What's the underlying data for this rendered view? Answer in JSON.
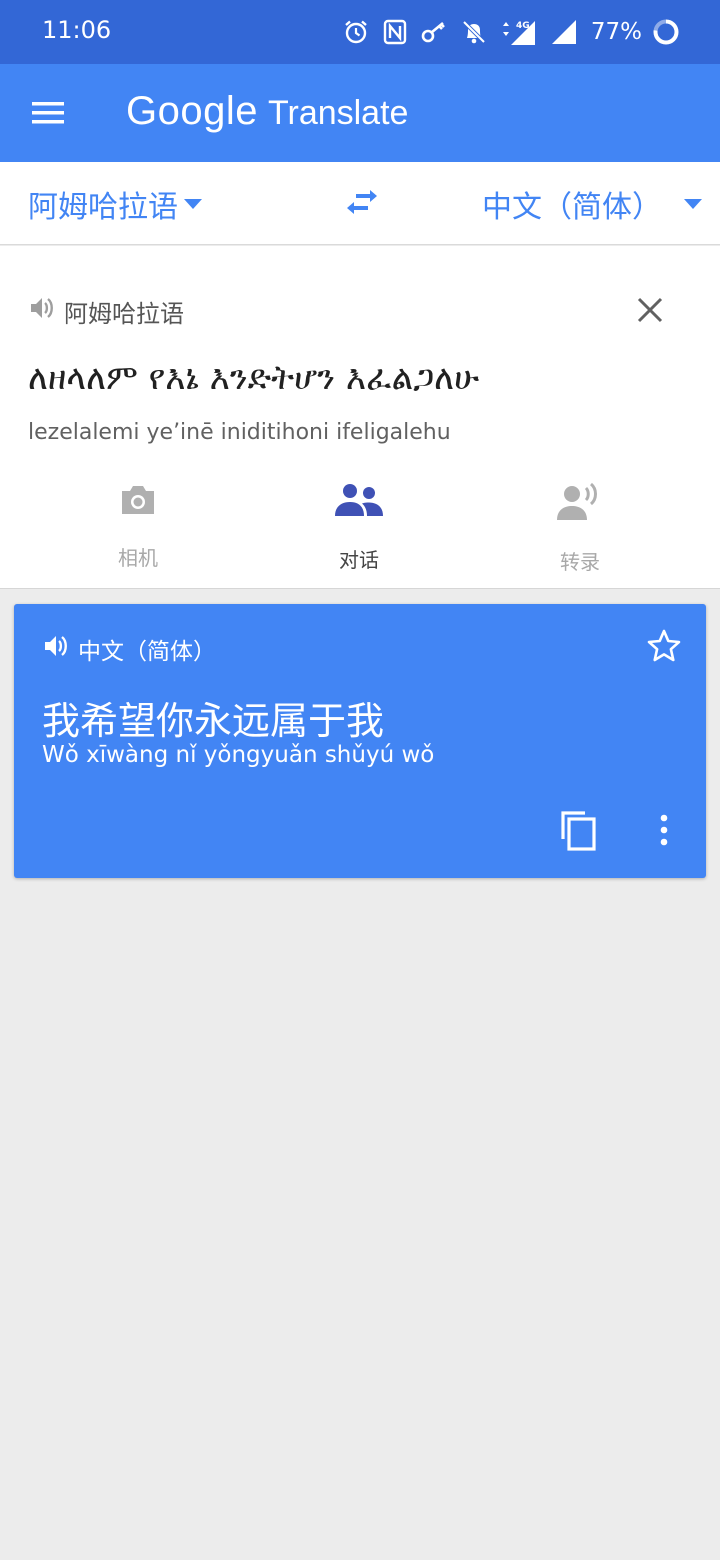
{
  "status_bar": {
    "time": "11:06",
    "network": "4G",
    "battery": "77%",
    "icons": [
      "alarm-icon",
      "nfc-icon",
      "vpn-key-icon",
      "notifications-off-icon",
      "data-arrows-icon",
      "signal-icon",
      "signal-icon",
      "battery-ring-icon"
    ]
  },
  "app_bar": {
    "brand": "Google",
    "product": "Translate"
  },
  "languages": {
    "source": "阿姆哈拉语",
    "target": "中文（简体）"
  },
  "input": {
    "source_lang_label": "阿姆哈拉语",
    "source_text": "ለዘላለም የእኔ እንድትሆን እፈልጋለሁ",
    "transliteration": "lezelalemi ye’inē iniditihoni ifeligalehu"
  },
  "tools": {
    "camera": "相机",
    "conversation": "对话",
    "transcribe": "转录"
  },
  "result": {
    "lang_label": "中文（简体）",
    "text": "我希望你永远属于我",
    "pinyin": "Wǒ xīwàng nǐ yǒngyuǎn shǔyú wǒ"
  },
  "colors": {
    "status_bar": "#3367d6",
    "primary": "#4285f4",
    "background": "#ececec",
    "active_tool": "#3f51b5"
  }
}
